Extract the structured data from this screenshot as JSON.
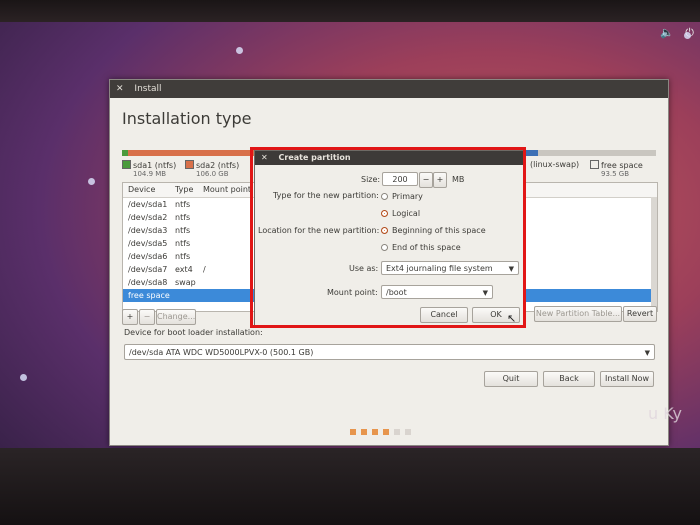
{
  "window": {
    "title": "Install",
    "heading": "Installation type"
  },
  "partition_legend": [
    {
      "name": "sda1 (ntfs)",
      "size": "104.9 MB",
      "color": "#4a9a3c"
    },
    {
      "name": "sda2 (ntfs)",
      "size": "106.0 GB",
      "color": "#d8704a"
    },
    {
      "name": "(linux-swap)",
      "size": "",
      "color": "#3c6fb5"
    },
    {
      "name": "free space",
      "size": "93.5 GB",
      "color": "#f0eee9"
    }
  ],
  "table": {
    "headers": [
      "Device",
      "Type",
      "Mount point"
    ],
    "rows": [
      {
        "device": "/dev/sda1",
        "type": "ntfs",
        "mount": ""
      },
      {
        "device": "/dev/sda2",
        "type": "ntfs",
        "mount": ""
      },
      {
        "device": "/dev/sda3",
        "type": "ntfs",
        "mount": ""
      },
      {
        "device": "/dev/sda5",
        "type": "ntfs",
        "mount": ""
      },
      {
        "device": "/dev/sda6",
        "type": "ntfs",
        "mount": ""
      },
      {
        "device": "/dev/sda7",
        "type": "ext4",
        "mount": "/"
      },
      {
        "device": "/dev/sda8",
        "type": "swap",
        "mount": ""
      },
      {
        "device": "free space",
        "type": "",
        "mount": ""
      }
    ]
  },
  "buttons": {
    "add": "+",
    "remove": "−",
    "change": "Change...",
    "new_table": "New Partition Table...",
    "revert": "Revert",
    "quit": "Quit",
    "back": "Back",
    "install": "Install Now"
  },
  "bootloader": {
    "label": "Device for boot loader installation:",
    "value": "/dev/sda    ATA WDC WD5000LPVX-0 (500.1 GB)"
  },
  "dialog": {
    "title": "Create partition",
    "size_label": "Size:",
    "size_value": "200",
    "size_minus": "−",
    "size_plus": "+",
    "size_unit": "MB",
    "type_label": "Type for the new partition:",
    "type_primary": "Primary",
    "type_logical": "Logical",
    "location_label": "Location for the new partition:",
    "loc_beginning": "Beginning of this space",
    "loc_end": "End of this space",
    "useas_label": "Use as:",
    "useas_value": "Ext4 journaling file system",
    "mount_label": "Mount point:",
    "mount_value": "/boot",
    "cancel": "Cancel",
    "ok": "OK"
  },
  "watermark": "u Ky"
}
